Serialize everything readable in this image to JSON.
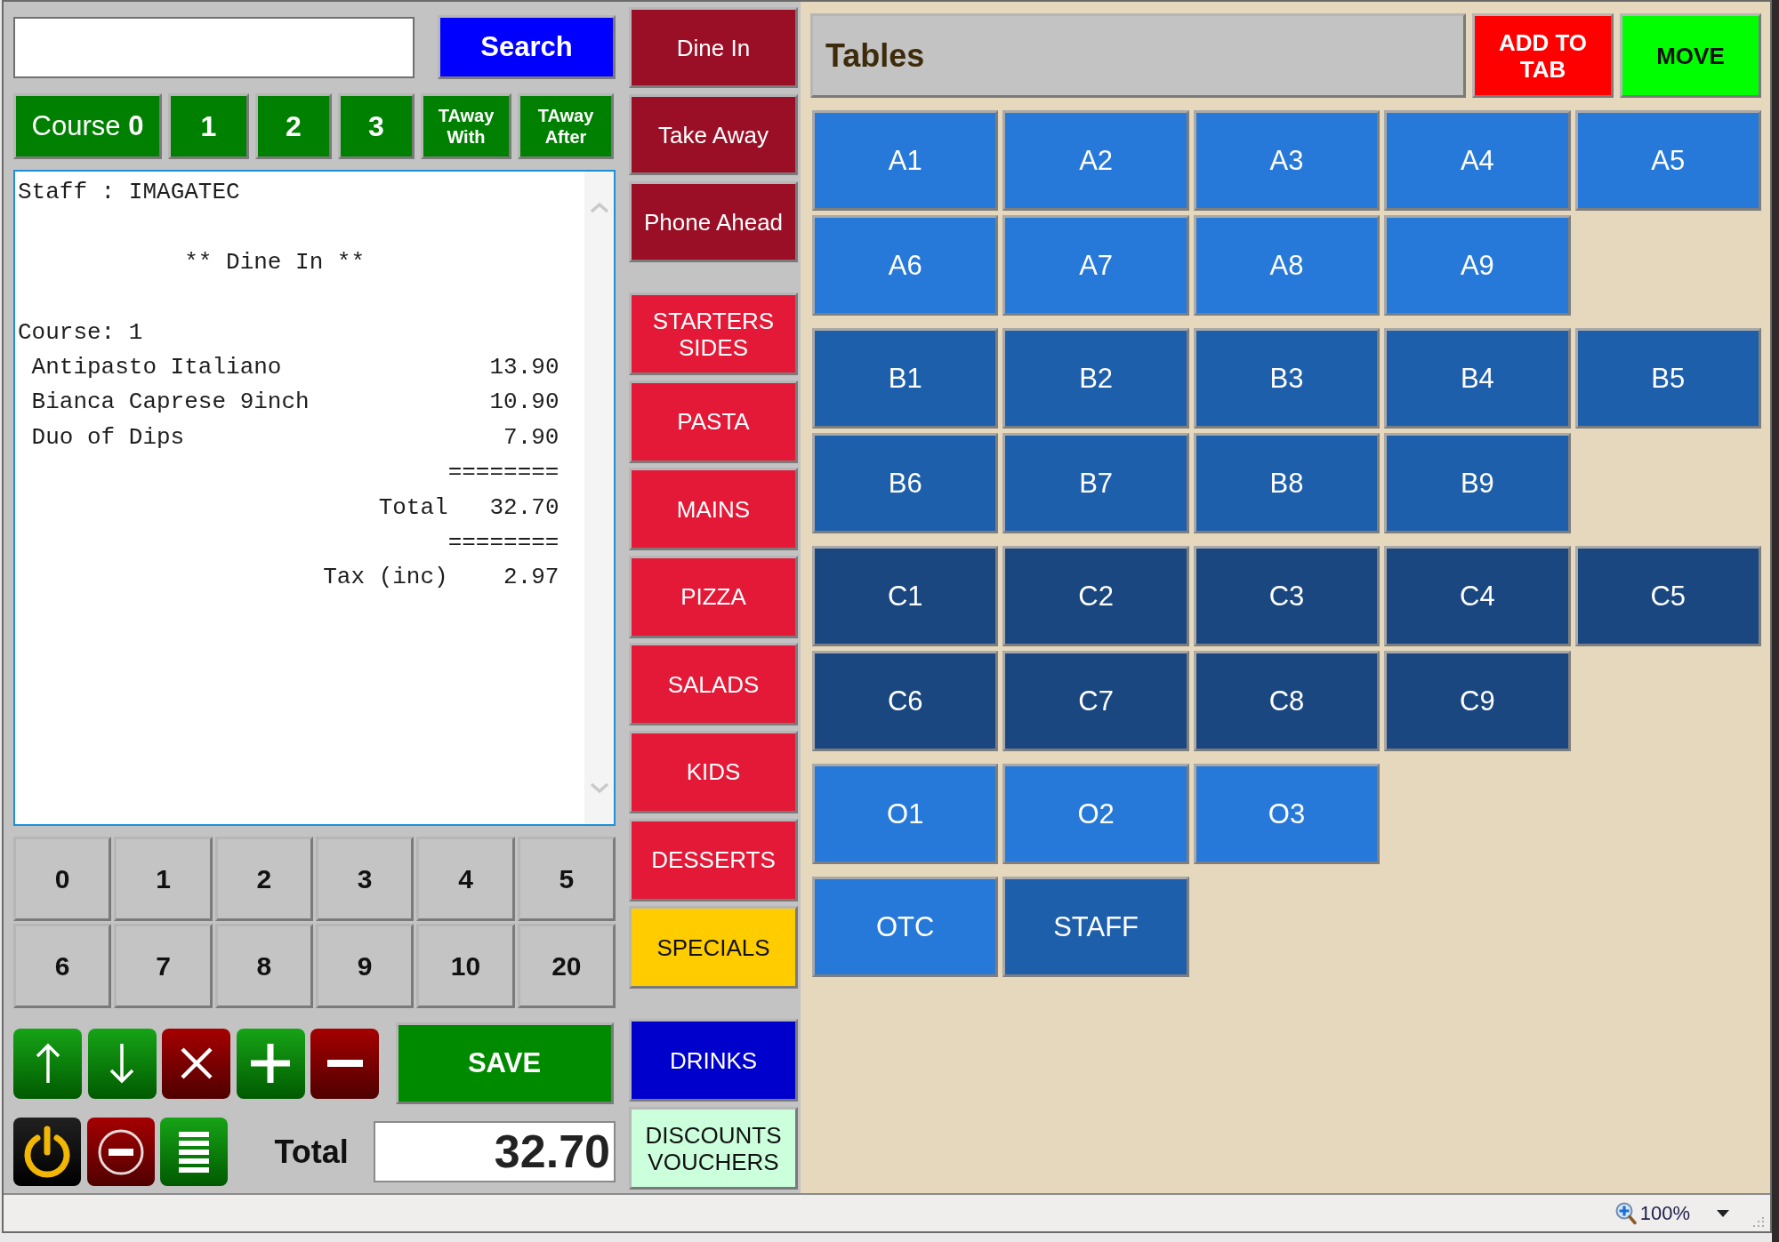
{
  "search": {
    "button": "Search"
  },
  "courses": [
    {
      "label": "Course **0**",
      "kind": "current"
    },
    {
      "label": "1",
      "kind": "number"
    },
    {
      "label": "2",
      "kind": "number"
    },
    {
      "label": "3",
      "kind": "number"
    },
    {
      "label": "TAway\nWith",
      "kind": "takeaway"
    },
    {
      "label": "TAway\nAfter",
      "kind": "takeaway"
    }
  ],
  "receipt": {
    "lines": [
      {
        "kind": "left",
        "text": "Staff : IMAGATEC"
      },
      {
        "kind": "center",
        "text": "** Dine In **"
      },
      {
        "kind": "left",
        "text": "Course: 1"
      },
      {
        "kind": "item",
        "text": "Antipasto Italiano",
        "amount": "13.90"
      },
      {
        "kind": "item",
        "text": "Bianca Caprese 9inch",
        "amount": "10.90"
      },
      {
        "kind": "item",
        "text": "Duo of Dips",
        "amount": "7.90"
      },
      {
        "kind": "rule",
        "text": "========"
      },
      {
        "kind": "sum",
        "text": "Total",
        "amount": "32.70"
      },
      {
        "kind": "rule",
        "text": "========"
      },
      {
        "kind": "sum",
        "text": "Tax (inc)",
        "amount": "2.97"
      }
    ]
  },
  "keypad": [
    "0",
    "1",
    "2",
    "3",
    "4",
    "5",
    "6",
    "7",
    "8",
    "9",
    "10",
    "20"
  ],
  "actions": [
    {
      "kind": "up"
    },
    {
      "kind": "down"
    },
    {
      "kind": "delete"
    },
    {
      "kind": "add"
    },
    {
      "kind": "remove"
    }
  ],
  "save": "SAVE",
  "tools": [
    {
      "kind": "power"
    },
    {
      "kind": "cancel"
    },
    {
      "kind": "list"
    }
  ],
  "total": {
    "label": "Total",
    "value": "32.70"
  },
  "order_types": [
    {
      "label": "Dine In"
    },
    {
      "label": "Take Away"
    },
    {
      "label": "Phone Ahead"
    }
  ],
  "categories": [
    {
      "label": "STARTERS\nSIDES",
      "color": "#e31937"
    },
    {
      "label": "PASTA",
      "color": "#e31937"
    },
    {
      "label": "MAINS",
      "color": "#e31937"
    },
    {
      "label": "PIZZA",
      "color": "#e31937"
    },
    {
      "label": "SALADS",
      "color": "#e31937"
    },
    {
      "label": "KIDS",
      "color": "#e31937"
    },
    {
      "label": "DESSERTS",
      "color": "#e31937"
    },
    {
      "label": "SPECIALS",
      "color": "#ffcc00"
    }
  ],
  "extras": [
    {
      "label": "DRINKS",
      "color": "#0000cc"
    },
    {
      "label": "DISCOUNTS\nVOUCHERS",
      "color": "#ccffdc"
    }
  ],
  "tables_panel": {
    "title": "Tables",
    "buttons": [
      {
        "label": "ADD TO\nTAB",
        "color": "#ff0000"
      },
      {
        "label": "MOVE",
        "color": "#00ff00"
      }
    ]
  },
  "table_groups": [
    {
      "tables": [
        {
          "label": "A1",
          "color": "#2679d8"
        },
        {
          "label": "A2",
          "color": "#2679d8"
        },
        {
          "label": "A3",
          "color": "#2679d8"
        },
        {
          "label": "A4",
          "color": "#2679d8"
        },
        {
          "label": "A5",
          "color": "#2679d8"
        },
        {
          "label": "A6",
          "color": "#2679d8"
        },
        {
          "label": "A7",
          "color": "#2679d8"
        },
        {
          "label": "A8",
          "color": "#2679d8"
        },
        {
          "label": "A9",
          "color": "#2679d8"
        }
      ]
    },
    {
      "tables": [
        {
          "label": "B1",
          "color": "#1e5fab"
        },
        {
          "label": "B2",
          "color": "#1e5fab"
        },
        {
          "label": "B3",
          "color": "#1e5fab"
        },
        {
          "label": "B4",
          "color": "#1e5fab"
        },
        {
          "label": "B5",
          "color": "#1e5fab"
        },
        {
          "label": "B6",
          "color": "#1e5fab"
        },
        {
          "label": "B7",
          "color": "#1e5fab"
        },
        {
          "label": "B8",
          "color": "#1e5fab"
        },
        {
          "label": "B9",
          "color": "#1e5fab"
        }
      ]
    },
    {
      "tables": [
        {
          "label": "C1",
          "color": "#1a4780"
        },
        {
          "label": "C2",
          "color": "#1a4780"
        },
        {
          "label": "C3",
          "color": "#1a4780"
        },
        {
          "label": "C4",
          "color": "#1a4780"
        },
        {
          "label": "C5",
          "color": "#1a4780"
        },
        {
          "label": "C6",
          "color": "#1a4780"
        },
        {
          "label": "C7",
          "color": "#1a4780"
        },
        {
          "label": "C8",
          "color": "#1a4780"
        },
        {
          "label": "C9",
          "color": "#1a4780"
        }
      ]
    },
    {
      "tables": [
        {
          "label": "O1",
          "color": "#2679d8"
        },
        {
          "label": "O2",
          "color": "#2679d8"
        },
        {
          "label": "O3",
          "color": "#2679d8"
        }
      ]
    },
    {
      "tables": [
        {
          "label": "OTC",
          "color": "#2679d8"
        },
        {
          "label": "STAFF",
          "color": "#1e5fab"
        }
      ]
    }
  ],
  "status_bar": {
    "zoom": "100%"
  }
}
